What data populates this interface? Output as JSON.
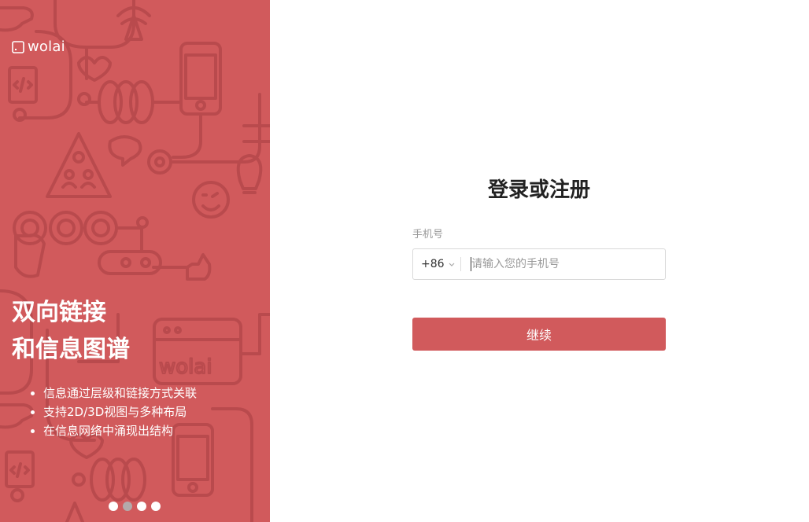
{
  "colors": {
    "brand": "#d15a5c",
    "pattern_line": "#b94a4d",
    "dot_active": "#b4aaaa",
    "title_text": "#222222"
  },
  "promo": {
    "logo_icon": "wolai-logo-icon",
    "logo_text": "wolai",
    "headline": [
      "双向链接",
      "和信息图谱"
    ],
    "features": [
      "信息通过层级和链接方式关联",
      "支持2D/3D视图与多种布局",
      "在信息网络中涌现出结构"
    ],
    "carousel": {
      "count": 4,
      "active_index": 1
    }
  },
  "login": {
    "title": "登录或注册",
    "phone_label": "手机号",
    "country_code": "+86",
    "phone_placeholder": "请输入您的手机号",
    "phone_value": "",
    "continue_label": "继续"
  }
}
